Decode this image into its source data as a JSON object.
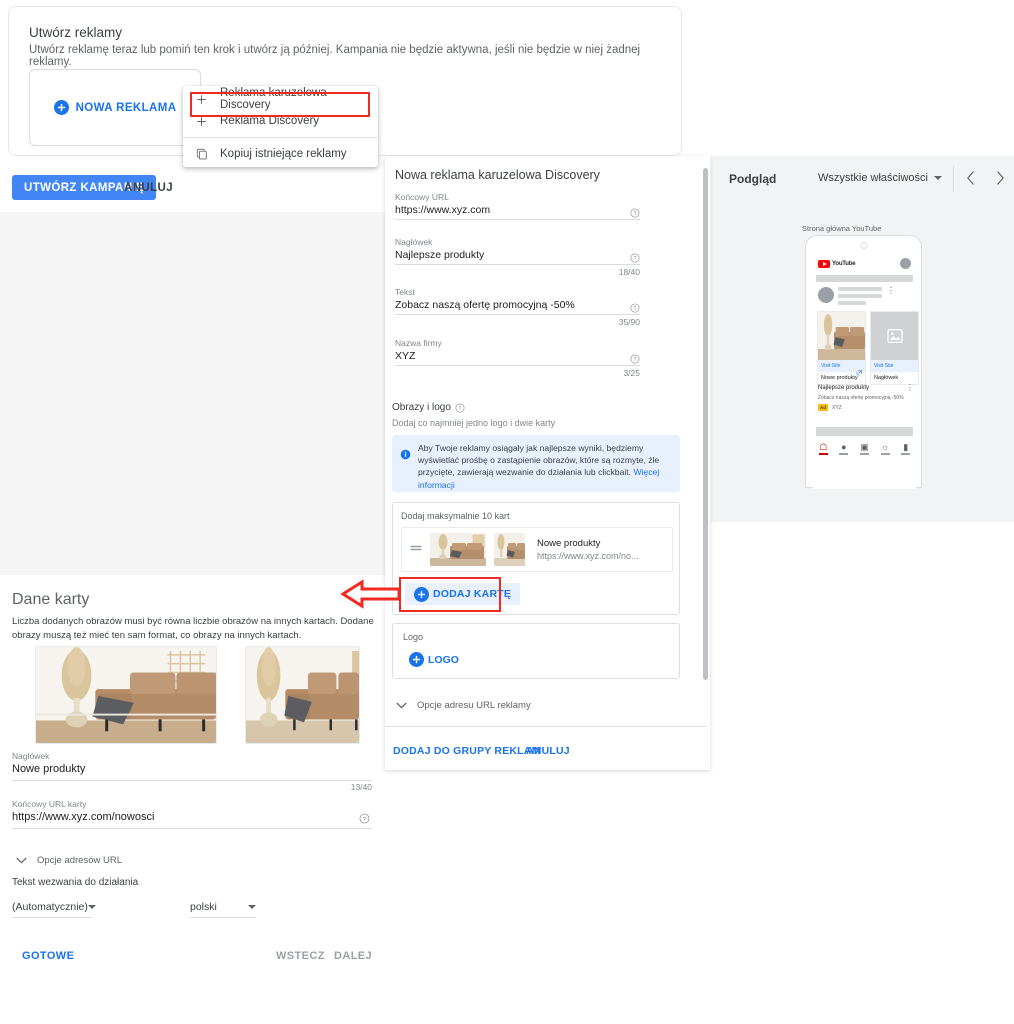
{
  "top_card": {
    "title": "Utwórz reklamy",
    "subtitle": "Utwórz reklamę teraz lub pomiń ten krok i utwórz ją później. Kampania nie będzie aktywna, jeśli nie będzie w niej żadnej reklamy.",
    "new_ad_button": "NOWA REKLAMA",
    "create_campaign_button": "UTWÓRZ KAMPANIĘ",
    "cancel_button": "ANULUJ"
  },
  "ad_type_menu": {
    "items": [
      {
        "label": "Reklama karuzelowa Discovery",
        "icon": "plus-icon",
        "highlighted": true
      },
      {
        "label": "Reklama Discovery",
        "icon": "plus-icon",
        "highlighted": false
      },
      {
        "label": "Kopiuj istniejące reklamy",
        "icon": "copy-icon",
        "highlighted": false
      }
    ]
  },
  "dialog": {
    "title": "Nowa reklama karuzelowa Discovery",
    "fields": [
      {
        "label": "Końcowy URL",
        "value": "https://www.xyz.com",
        "counter": ""
      },
      {
        "label": "Nagłówek",
        "value": "Najlepsze produkty",
        "counter": "18/40"
      },
      {
        "label": "Tekst",
        "value": "Zobacz naszą ofertę promocyjną -50%",
        "counter": "35/90"
      },
      {
        "label": "Nazwa firmy",
        "value": "XYZ",
        "counter": "3/25"
      }
    ],
    "images_section": {
      "title": "Obrazy i logo",
      "subtitle": "Dodaj co najmniej jedno logo i dwie karty",
      "info_text": "Aby Twoje reklamy osiągały jak najlepsze wyniki, będziemy wyświetlać prośbę o zastąpienie obrazów, które są rozmyte, źle przycięte, zawierają wezwanie do działania lub clickbait. ",
      "info_link": "Więcej informacji"
    },
    "cards_box": {
      "label": "Dodaj maksymalnie 10 kart",
      "card_title": "Nowe produkty",
      "card_url": "https://www.xyz.com/no...",
      "add_card_button": "DODAJ KARTĘ"
    },
    "logo_box": {
      "label": "Logo",
      "add_logo_button": "LOGO"
    },
    "url_options_label": "Opcje adresu URL reklamy",
    "add_to_group_button": "DODAJ DO GRUPY REKLAM",
    "cancel_button": "ANULUJ"
  },
  "preview": {
    "title": "Podgląd",
    "property_selector": "Wszystkie właściwości",
    "placement_label": "Strona główna YouTube",
    "youtube_word": "YouTube",
    "card1": {
      "visit": "Visit Site",
      "caption": "Nowe produkty"
    },
    "card2": {
      "visit": "Visit Site",
      "caption": "Nagłówek"
    },
    "headline": "Najlepsze produkty",
    "description": "Zobacz naszą ofertę promocyjną -50%",
    "ad_badge": "Ad",
    "brand": "XYZ"
  },
  "card_data": {
    "title": "Dane karty",
    "description": "Liczba dodanych obrazów musi być równa liczbie obrazów na innych kartach. Dodane obrazy muszą też mieć ten sam format, co obrazy na innych kartach.",
    "headline_label": "Nagłówek",
    "headline_value": "Nowe produkty",
    "headline_counter": "13/40",
    "url_label": "Końcowy URL karty",
    "url_value": "https://www.xyz.com/nowosci",
    "url_options_label": "Opcje adresów URL",
    "cta_label": "Tekst wezwania do działania",
    "cta_value": "(Automatycznie)",
    "language_value": "polski",
    "done_button": "GOTOWE",
    "back_button": "WSTECZ",
    "next_button": "DALEJ"
  },
  "colors": {
    "accent_blue": "#1a73e8",
    "button_blue": "#4285f4",
    "info_bg": "#e8f0fe",
    "annotation_red": "#ef2a22",
    "youtube_red": "#ff0000",
    "ad_badge_yellow": "#fbbc04"
  }
}
